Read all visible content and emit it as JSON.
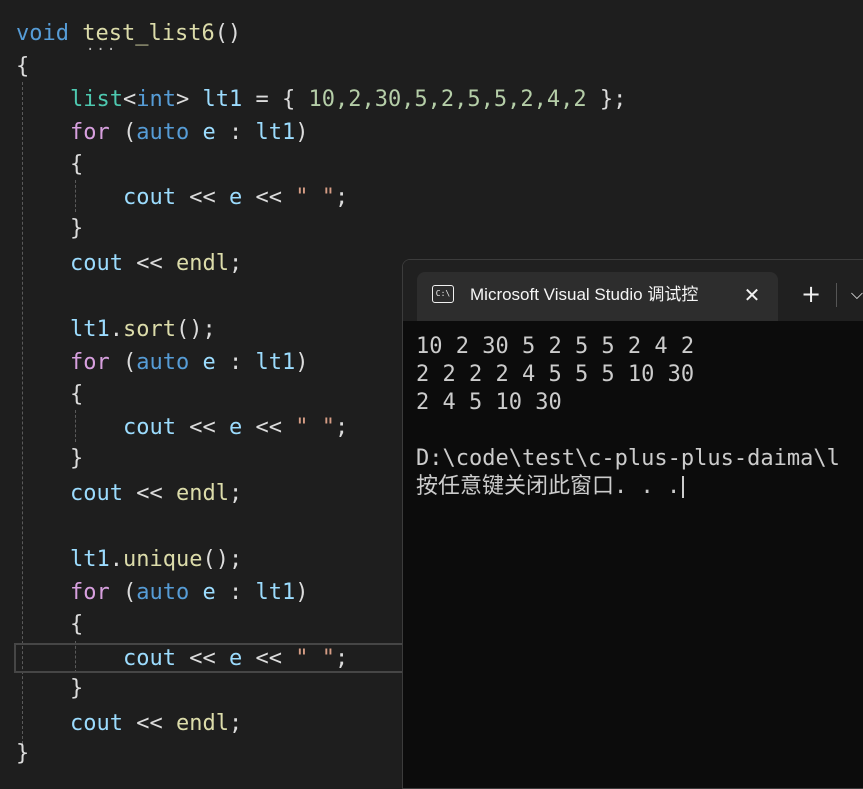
{
  "code": {
    "l1": {
      "kw": "void",
      "fn": "test_list6",
      "rest": "()"
    },
    "l2": {
      "brace": "{"
    },
    "l3": {
      "type": "list",
      "lt": "<",
      "type2": "int",
      "gt": ">",
      "var": "lt1",
      "eq": " = { ",
      "nums": "10,2,30,5,2,5,5,2,4,2",
      "end": " };"
    },
    "l4": {
      "kw": "for",
      "p1": " (",
      "auto": "auto",
      "e": "e",
      "colon": " : ",
      "lt": "lt1",
      "p2": ")"
    },
    "l5": {
      "brace": "{"
    },
    "l6": {
      "cout": "cout",
      "op1": " << ",
      "e": "e",
      "op2": " << ",
      "str": "\" \"",
      "semi": ";"
    },
    "l7": {
      "brace": "}"
    },
    "l8": {
      "cout": "cout",
      "op": " << ",
      "endl": "endl",
      "semi": ";"
    },
    "l10": {
      "var": "lt1",
      "dot": ".",
      "fn": "sort",
      "rest": "();"
    },
    "l11": {
      "kw": "for",
      "p1": " (",
      "auto": "auto",
      "e": "e",
      "colon": " : ",
      "lt": "lt1",
      "p2": ")"
    },
    "l12": {
      "brace": "{"
    },
    "l13": {
      "cout": "cout",
      "op1": " << ",
      "e": "e",
      "op2": " << ",
      "str": "\" \"",
      "semi": ";"
    },
    "l14": {
      "brace": "}"
    },
    "l15": {
      "cout": "cout",
      "op": " << ",
      "endl": "endl",
      "semi": ";"
    },
    "l17": {
      "var": "lt1",
      "dot": ".",
      "fn": "unique",
      "rest": "();"
    },
    "l18": {
      "kw": "for",
      "p1": " (",
      "auto": "auto",
      "e": "e",
      "colon": " : ",
      "lt": "lt1",
      "p2": ")"
    },
    "l19": {
      "brace": "{"
    },
    "l20": {
      "cout": "cout",
      "op1": " << ",
      "e": "e",
      "op2": " << ",
      "str": "\" \"",
      "semi": ";"
    },
    "l21": {
      "brace": "}"
    },
    "l22": {
      "cout": "cout",
      "op": " << ",
      "endl": "endl",
      "semi": ";"
    },
    "l23": {
      "brace": "}"
    }
  },
  "terminal": {
    "tab_title": "Microsoft Visual Studio 调试控",
    "tab_icon": "C:\\",
    "close_glyph": "✕",
    "new_tab_glyph": "+",
    "dropdown_glyph": "⌵",
    "lines": [
      "10 2 30 5 2 5 5 2 4 2",
      "2 2 2 2 4 5 5 5 10 30",
      "2 4 5 10 30",
      "",
      "D:\\code\\test\\c-plus-plus-daima\\l",
      "按任意键关闭此窗口. . ."
    ]
  }
}
